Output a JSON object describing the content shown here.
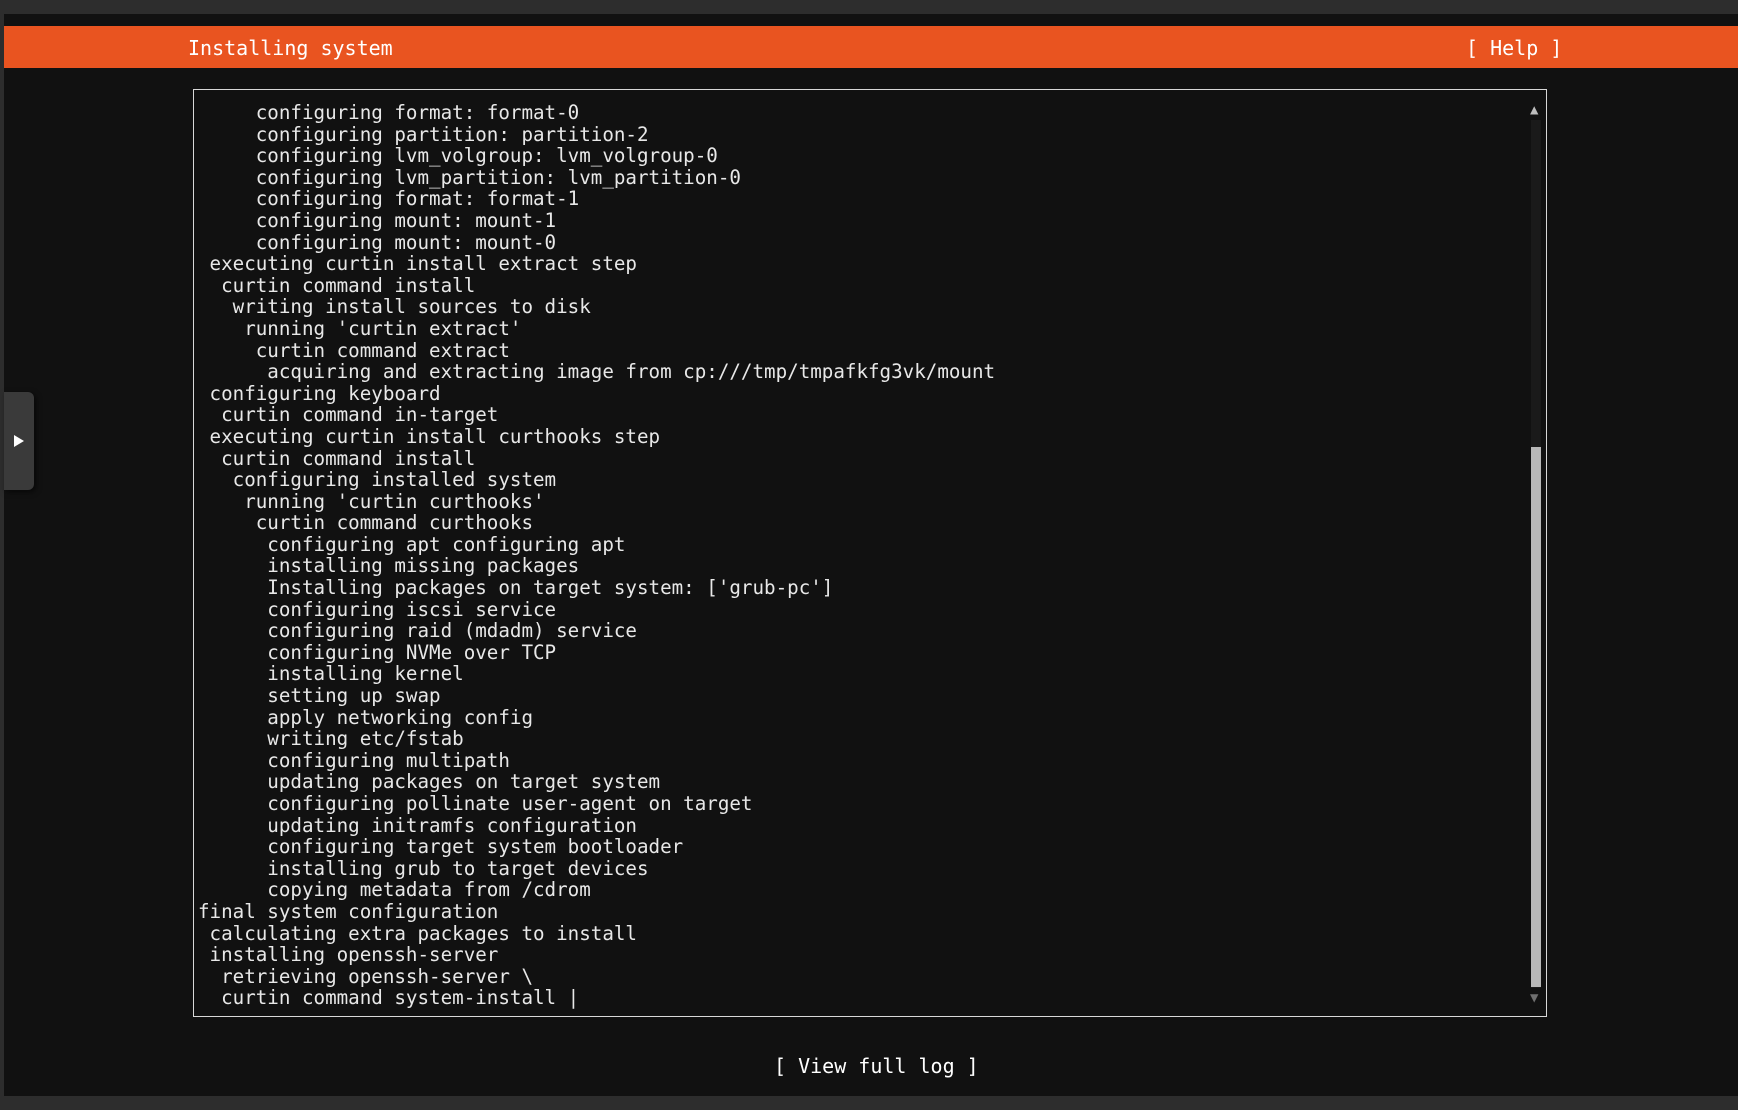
{
  "header": {
    "title": "Installing system",
    "help_label": "[ Help ]",
    "accent_color": "#e95420"
  },
  "log": {
    "lines": [
      "     configuring format: format-0",
      "     configuring partition: partition-2",
      "     configuring lvm_volgroup: lvm_volgroup-0",
      "     configuring lvm_partition: lvm_partition-0",
      "     configuring format: format-1",
      "     configuring mount: mount-1",
      "     configuring mount: mount-0",
      " executing curtin install extract step",
      "  curtin command install",
      "   writing install sources to disk",
      "    running 'curtin extract'",
      "     curtin command extract",
      "      acquiring and extracting image from cp:///tmp/tmpafkfg3vk/mount",
      " configuring keyboard",
      "  curtin command in-target",
      " executing curtin install curthooks step",
      "  curtin command install",
      "   configuring installed system",
      "    running 'curtin curthooks'",
      "     curtin command curthooks",
      "      configuring apt configuring apt",
      "      installing missing packages",
      "      Installing packages on target system: ['grub-pc']",
      "      configuring iscsi service",
      "      configuring raid (mdadm) service",
      "      configuring NVMe over TCP",
      "      installing kernel",
      "      setting up swap",
      "      apply networking config",
      "      writing etc/fstab",
      "      configuring multipath",
      "      updating packages on target system",
      "      configuring pollinate user-agent on target",
      "      updating initramfs configuration",
      "      configuring target system bootloader",
      "      installing grub to target devices",
      "      copying metadata from /cdrom",
      "final system configuration",
      " calculating extra packages to install",
      " installing openssh-server",
      "  retrieving openssh-server \\",
      "  curtin command system-install "
    ],
    "cursor_glyph": "|",
    "scroll_position": 1.0
  },
  "footer": {
    "view_log_label": "[ View full log ]"
  },
  "icons": {
    "side_tab": "play-triangle-icon",
    "scroll_up": "scroll-up-arrow-icon",
    "scroll_down": "scroll-down-arrow-icon"
  }
}
